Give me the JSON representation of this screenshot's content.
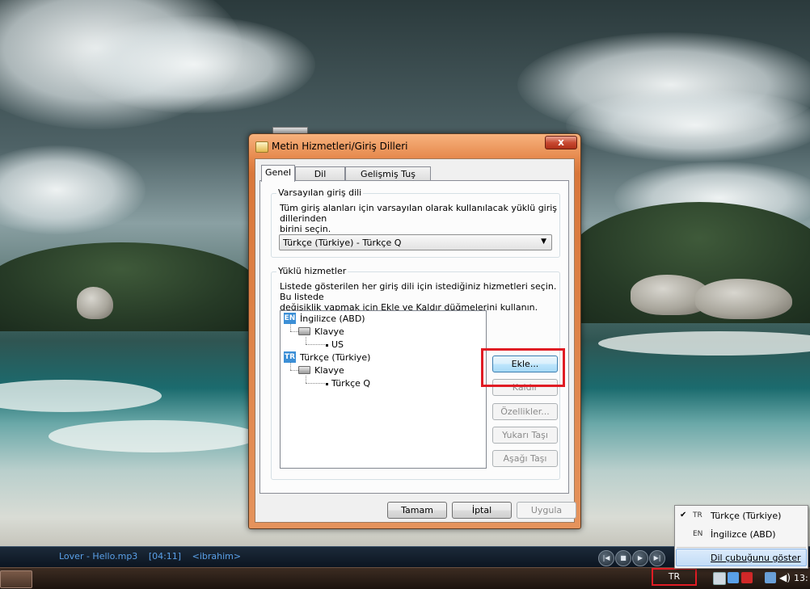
{
  "dialog": {
    "title": "Metin Hizmetleri/Giriş Dilleri",
    "close_label": "x",
    "tabs": [
      "Genel",
      "Dil Çubuğu",
      "Gelişmiş Tuş Ayarları"
    ],
    "default_lang_group": {
      "title": "Varsayılan giriş dili",
      "description_line1": "Tüm giriş alanları için varsayılan olarak kullanılacak yüklü giriş dillerinden",
      "description_line2": "birini seçin.",
      "selected": "Türkçe (Türkiye) - Türkçe Q"
    },
    "services_group": {
      "title": "Yüklü hizmetler",
      "description_line1": "Listede gösterilen her giriş dili için istediğiniz hizmetleri seçin. Bu listede",
      "description_line2": "değişiklik yapmak için Ekle ve Kaldır düğmelerini kullanın.",
      "tree": [
        {
          "code": "EN",
          "language": "İngilizce (ABD)",
          "category": "Klavye",
          "layout": "US"
        },
        {
          "code": "TR",
          "language": "Türkçe (Türkiye)",
          "category": "Klavye",
          "layout": "Türkçe Q"
        }
      ],
      "buttons": {
        "add": "Ekle...",
        "remove": "Kaldır",
        "properties": "Özellikler...",
        "move_up": "Yukarı Taşı",
        "move_down": "Aşağı Taşı"
      }
    },
    "footer": {
      "ok": "Tamam",
      "cancel": "İptal",
      "apply": "Uygula"
    }
  },
  "language_menu": {
    "items": [
      {
        "checked": true,
        "code": "TR",
        "label": "Türkçe (Türkiye)"
      },
      {
        "checked": false,
        "code": "EN",
        "label": "İngilizce (ABD)"
      }
    ],
    "check_mark": "✔",
    "show_bar": "Dil çubuğunu göster"
  },
  "media_bar": {
    "track": "Lover - Hello.mp3",
    "duration": "[04:11]",
    "artist": "ibrahim>",
    "artist_prefix": "<"
  },
  "taskbar": {
    "language_indicator": "TR",
    "clock": "13:"
  },
  "colors": {
    "highlight_red": "#e01c24",
    "title_orange": "#e6894d",
    "lang_badge_blue": "#3c8fd6"
  }
}
